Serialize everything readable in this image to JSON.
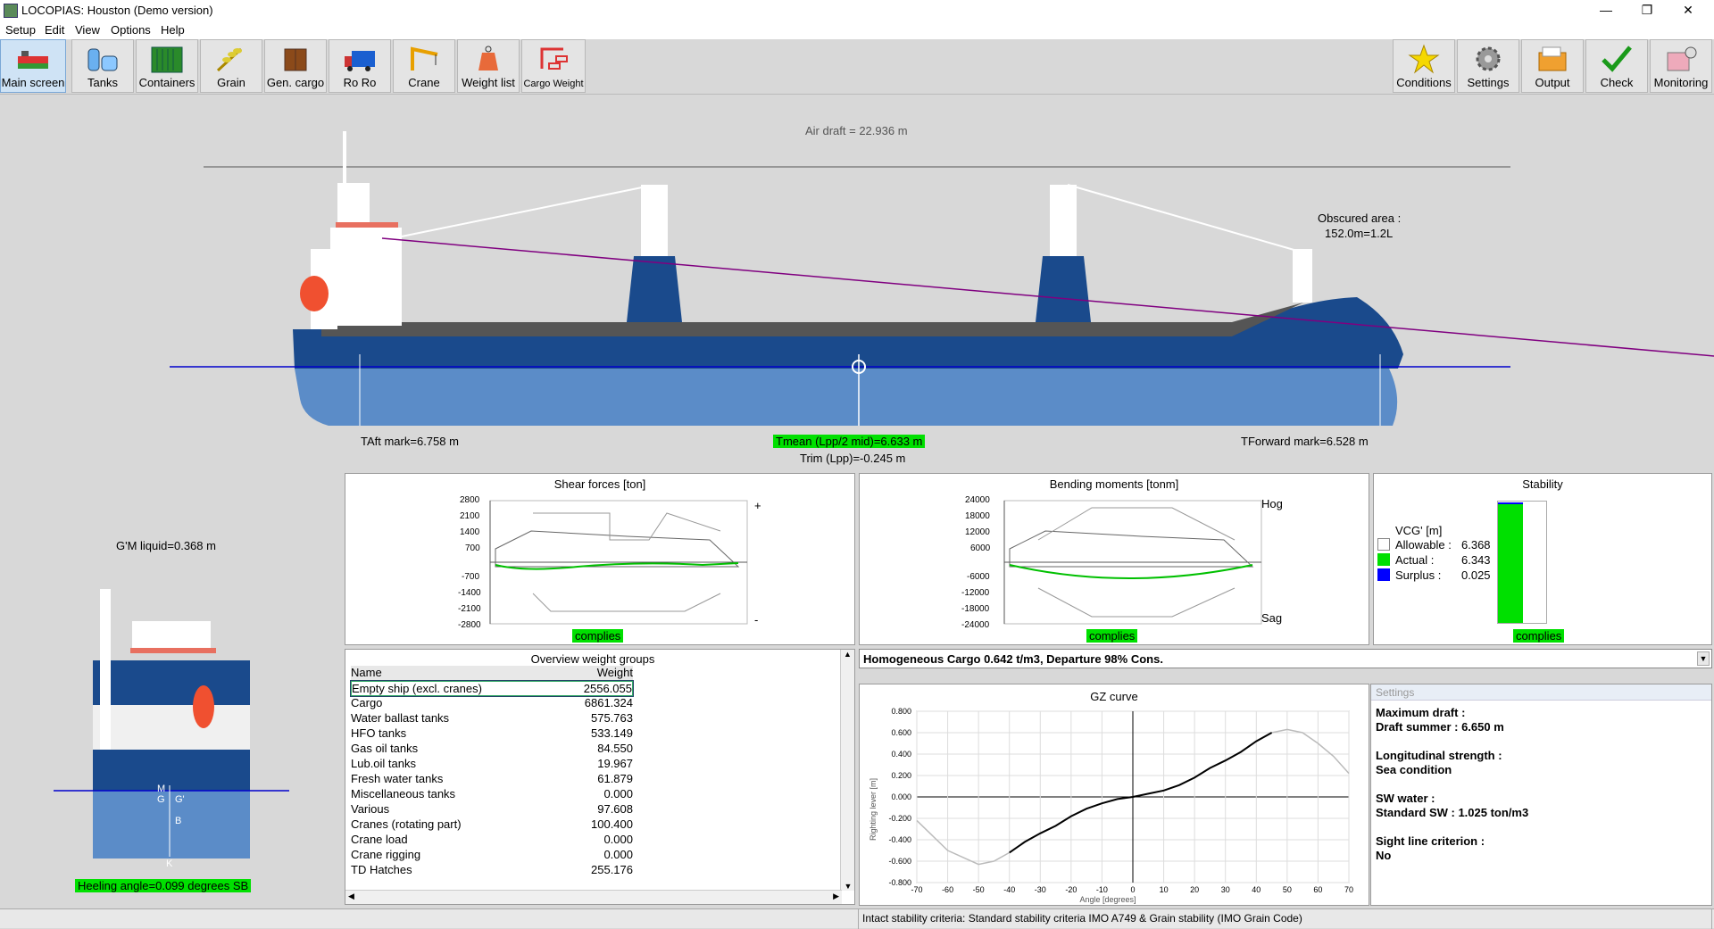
{
  "window": {
    "title": "LOCOPIAS: Houston (Demo version)"
  },
  "menu": [
    "Setup",
    "Edit",
    "View",
    "Options",
    "Help"
  ],
  "toolbar": {
    "left": [
      "Main screen",
      "Tanks",
      "Containers",
      "Grain",
      "Gen. cargo",
      "Ro Ro",
      "Crane",
      "Weight list",
      "Cargo Weight"
    ],
    "right": [
      "Conditions",
      "Settings",
      "Output",
      "Check",
      "Monitoring"
    ]
  },
  "profile": {
    "air_draft": "Air draft = 22.936 m",
    "obscured_line1": "Obscured area :",
    "obscured_line2": "152.0m=1.2L",
    "t_aft": "TAft mark=6.758 m",
    "t_mean": "Tmean (Lpp/2 mid)=6.633 m",
    "trim": "Trim (Lpp)=-0.245 m",
    "t_fwd": "TForward mark=6.528 m"
  },
  "section": {
    "gm": "G'M liquid=0.368 m",
    "heeling": "Heeling angle=0.099 degrees SB",
    "markers": {
      "m": "M",
      "g": "G",
      "gprime": "G'",
      "b": "B",
      "k": "K"
    }
  },
  "shear": {
    "title": "Shear forces [ton]",
    "ticks": [
      "2800",
      "2100",
      "1400",
      "700",
      "-700",
      "-1400",
      "-2100",
      "-2800"
    ],
    "plus": "+",
    "minus": "-",
    "status": "complies"
  },
  "bending": {
    "title": "Bending moments [tonm]",
    "ticks": [
      "24000",
      "18000",
      "12000",
      "6000",
      "-6000",
      "-12000",
      "-18000",
      "-24000"
    ],
    "hog": "Hog",
    "sag": "Sag",
    "status": "complies"
  },
  "stability": {
    "title": "Stability",
    "vcg_label": "VCG' [m]",
    "rows": [
      {
        "label": "Allowable :",
        "value": "6.368",
        "color": "#ffffff"
      },
      {
        "label": "Actual :",
        "value": "6.343",
        "color": "#00e000"
      },
      {
        "label": "Surplus :",
        "value": "0.025",
        "color": "#0000ff"
      }
    ],
    "bar_fraction": 0.996,
    "status": "complies"
  },
  "weights": {
    "title": "Overview weight groups",
    "header": {
      "name": "Name",
      "weight": "Weight"
    },
    "rows": [
      {
        "name": "Empty ship (excl. cranes)",
        "weight": "2556.055"
      },
      {
        "name": "Cargo",
        "weight": "6861.324"
      },
      {
        "name": "Water ballast tanks",
        "weight": "575.763"
      },
      {
        "name": "HFO tanks",
        "weight": "533.149"
      },
      {
        "name": "Gas oil tanks",
        "weight": "84.550"
      },
      {
        "name": "Lub.oil tanks",
        "weight": "19.967"
      },
      {
        "name": "Fresh water tanks",
        "weight": "61.879"
      },
      {
        "name": "Miscellaneous tanks",
        "weight": "0.000"
      },
      {
        "name": "Various",
        "weight": "97.608"
      },
      {
        "name": "Cranes (rotating part)",
        "weight": "100.400"
      },
      {
        "name": "Crane load",
        "weight": "0.000"
      },
      {
        "name": "Crane rigging",
        "weight": "0.000"
      },
      {
        "name": "TD Hatches",
        "weight": "255.176"
      }
    ]
  },
  "condition": {
    "selected": "Homogeneous Cargo 0.642 t/m3, Departure 98% Cons."
  },
  "gz": {
    "title": "GZ curve",
    "y_ticks": [
      "0.800",
      "0.600",
      "0.400",
      "0.200",
      "0.000",
      "-0.200",
      "-0.400",
      "-0.600",
      "-0.800"
    ],
    "x_ticks": [
      "-70",
      "-60",
      "-50",
      "-40",
      "-30",
      "-20",
      "-10",
      "0",
      "10",
      "20",
      "30",
      "40",
      "50",
      "60",
      "70"
    ],
    "xlabel": "Angle [degrees]",
    "ylabel": "Righting lever [m]"
  },
  "chart_data": {
    "type": "line",
    "title": "GZ curve",
    "xlabel": "Angle [degrees]",
    "ylabel": "Righting lever [m]",
    "xlim": [
      -70,
      70
    ],
    "ylim": [
      -0.8,
      0.8
    ],
    "series": [
      {
        "x": [
          -70,
          -60,
          -50,
          -45,
          -40,
          -35,
          -30,
          -25,
          -20,
          -15,
          -10,
          -5,
          0,
          5,
          10,
          15,
          20,
          25,
          30,
          35,
          40,
          45,
          50,
          55,
          60,
          65,
          70
        ],
        "y": [
          -0.22,
          -0.5,
          -0.63,
          -0.6,
          -0.52,
          -0.42,
          -0.34,
          -0.27,
          -0.18,
          -0.11,
          -0.06,
          -0.02,
          0,
          0.03,
          0.06,
          0.11,
          0.18,
          0.27,
          0.34,
          0.42,
          0.52,
          0.6,
          0.63,
          0.6,
          0.5,
          0.38,
          0.22
        ]
      }
    ]
  },
  "settings_panel": {
    "header": "Settings",
    "lines": [
      "Maximum draft :",
      "Draft summer : 6.650 m",
      "",
      "Longitudinal strength :",
      "Sea condition",
      "",
      "SW water :",
      "Standard SW : 1.025 ton/m3",
      "",
      "Sight line criterion :",
      "No"
    ]
  },
  "status_bar": {
    "text": "Intact stability criteria: Standard stability criteria IMO A749 & Grain stability (IMO Grain Code)"
  },
  "colors": {
    "hull_dark": "#1a4a8c",
    "hull_light": "#5b8cc8",
    "deck_grey": "#555555",
    "waterline": "#0000cc",
    "sightline": "#800080",
    "green_ok": "#00e000"
  }
}
